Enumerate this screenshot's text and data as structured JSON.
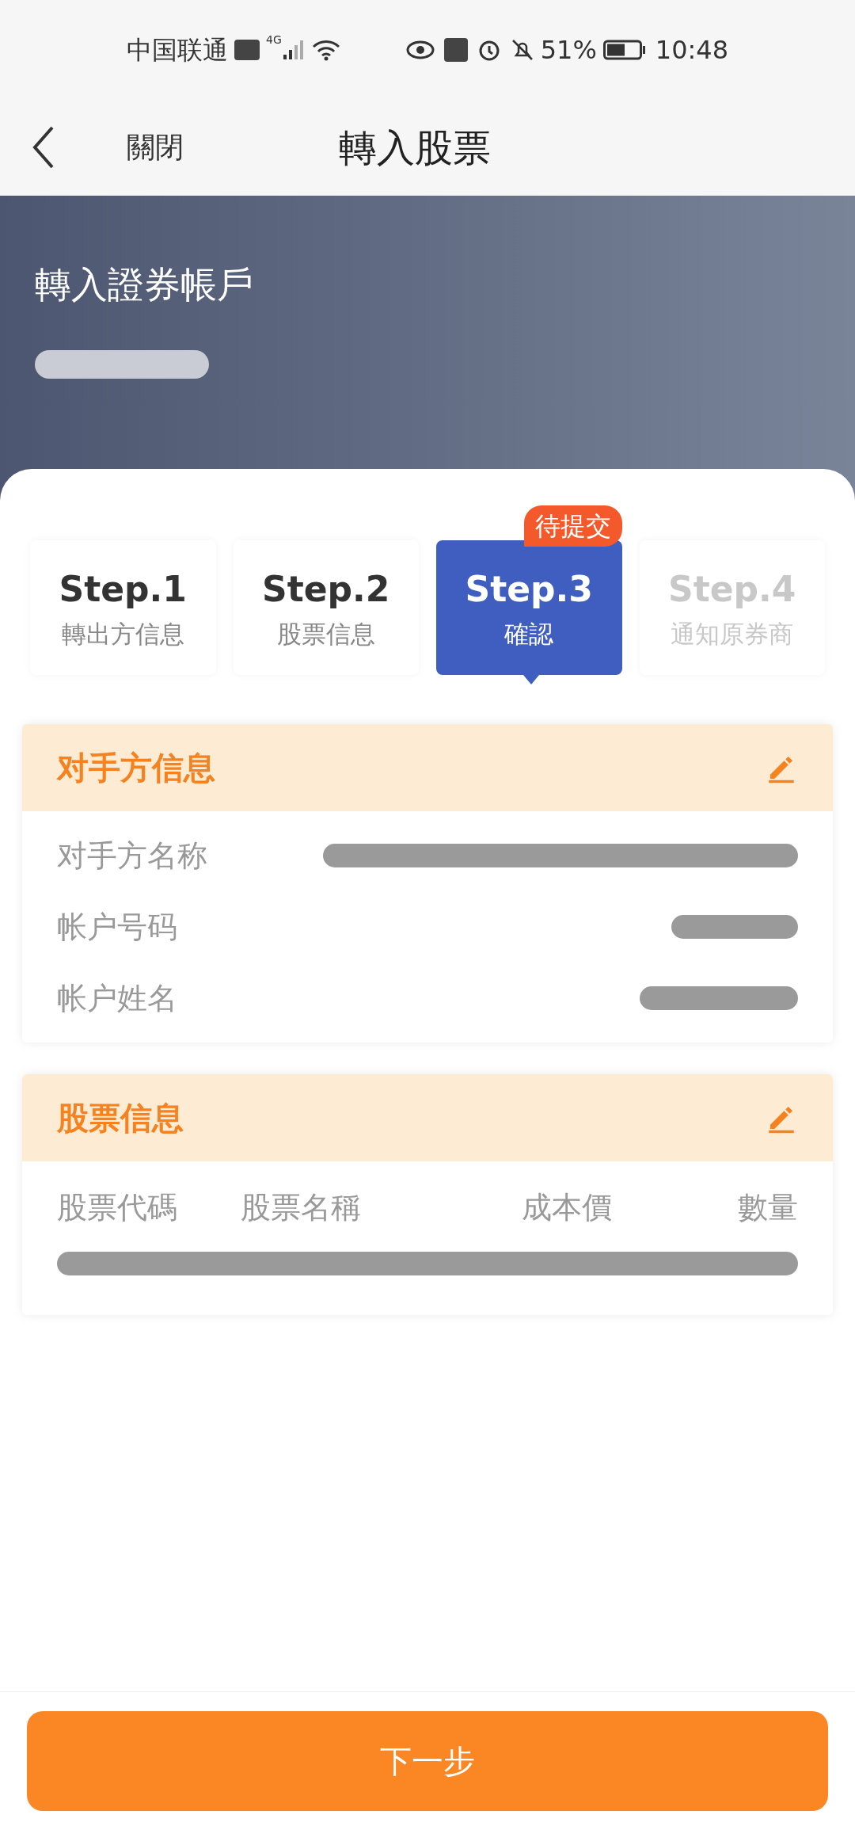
{
  "status_bar": {
    "carrier": "中国联通",
    "network": "4G",
    "battery": "51%",
    "time": "10:48"
  },
  "nav": {
    "close": "關閉",
    "title": "轉入股票"
  },
  "banner": {
    "title": "轉入證券帳戶",
    "account_redacted": true
  },
  "steps": [
    {
      "label": "Step.1",
      "caption": "轉出方信息",
      "selected": false,
      "disabled": false
    },
    {
      "label": "Step.2",
      "caption": "股票信息",
      "selected": false,
      "disabled": false
    },
    {
      "label": "Step.3",
      "caption": "確認",
      "selected": true,
      "disabled": false,
      "badge": "待提交"
    },
    {
      "label": "Step.4",
      "caption": "通知原券商",
      "selected": false,
      "disabled": true
    }
  ],
  "counterparty": {
    "title": "对手方信息",
    "rows": [
      {
        "label": "对手方名称",
        "redacted": true
      },
      {
        "label": "帐户号码",
        "redacted": true
      },
      {
        "label": "帐户姓名",
        "redacted": true
      }
    ]
  },
  "stocks": {
    "title": "股票信息",
    "columns": [
      "股票代碼",
      "股票名稱",
      "成本價",
      "數量"
    ],
    "rows_redacted": true
  },
  "next_button": "下一步"
}
